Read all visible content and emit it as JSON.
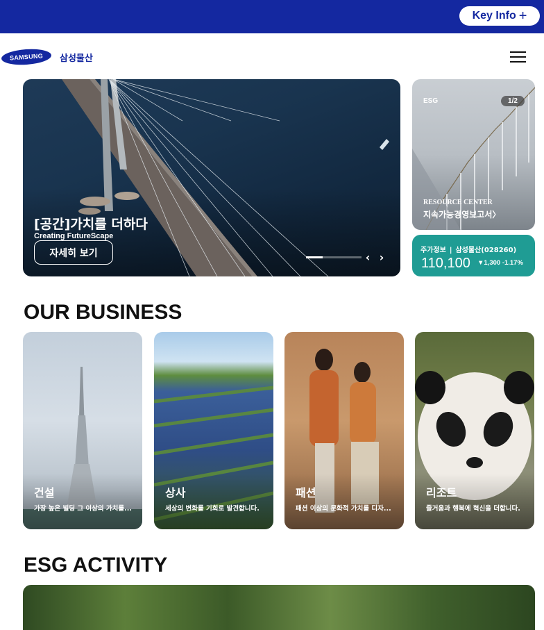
{
  "topbar": {
    "key_info_label": "Key Info",
    "key_info_icon": "plus-icon"
  },
  "header": {
    "logo_text": "SAMSUNG",
    "company_name": "삼성물산",
    "menu_icon": "hamburger-menu-icon"
  },
  "hero": {
    "title": "[공간]가치를 더하다",
    "subtitle": "Creating FutureScape",
    "button_label": "자세히 보기",
    "progress": 0.3,
    "prev_label": "‹",
    "next_label": "›"
  },
  "esg_card": {
    "label": "ESG",
    "pager": "1/2",
    "resource_center": "RESOURCE CENTER",
    "link_label": "지속가능경영보고서〉"
  },
  "stock": {
    "label": "주가정보",
    "separator": "|",
    "company": "삼성물산(028260)",
    "price": "110,100",
    "change": "▼1,300 -1.17%",
    "color": "#1f9c94"
  },
  "business": {
    "section_title": "OUR BUSINESS",
    "cards": [
      {
        "name": "건설",
        "desc": "가장 높은 빌딩 그 이상의 가치를..."
      },
      {
        "name": "상사",
        "desc": "세상의 변화를 기회로 발견합니다."
      },
      {
        "name": "패션",
        "desc": "패션 이상의 문화적 가치를 디자..."
      },
      {
        "name": "리조트",
        "desc": "즐거움과 행복에 혁신을 더합니다."
      }
    ]
  },
  "esg_activity": {
    "section_title": "ESG ACTIVITY"
  },
  "colors": {
    "brand_blue": "#1428a0",
    "teal": "#1f9c94"
  }
}
